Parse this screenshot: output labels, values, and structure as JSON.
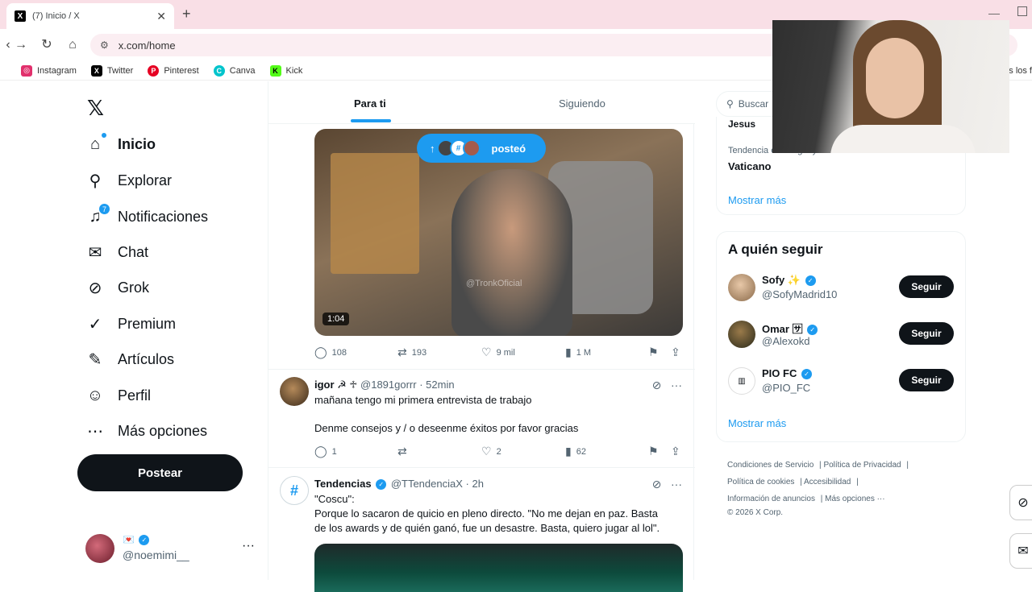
{
  "browser": {
    "tab_title": "(7) Inicio / X",
    "tab_close": "✕",
    "new_tab": "+",
    "url": "x.com/home",
    "bookmarks": [
      {
        "label": "Instagram",
        "color": "#e1306c",
        "glyph": "◎"
      },
      {
        "label": "Twitter",
        "color": "#000000",
        "glyph": "X"
      },
      {
        "label": "Pinterest",
        "color": "#e60023",
        "glyph": "P"
      },
      {
        "label": "Canva",
        "color": "#00c4cc",
        "glyph": "C"
      },
      {
        "label": "Kick",
        "color": "#53fc18",
        "glyph": "K"
      }
    ],
    "bookmarks_more": "as los f"
  },
  "nav": {
    "logo": "𝕏",
    "items": [
      {
        "label": "Inicio",
        "icon": "home-icon",
        "glyph": "⌂"
      },
      {
        "label": "Explorar",
        "icon": "search-icon",
        "glyph": "⚲"
      },
      {
        "label": "Notificaciones",
        "icon": "bell-icon",
        "glyph": "🔔",
        "badge": "7"
      },
      {
        "label": "Chat",
        "icon": "mail-icon",
        "glyph": "✉"
      },
      {
        "label": "Grok",
        "icon": "grok-icon",
        "glyph": "⊘"
      },
      {
        "label": "Premium",
        "icon": "premium-icon",
        "glyph": "✓"
      },
      {
        "label": "Artículos",
        "icon": "articles-icon",
        "glyph": "✎"
      },
      {
        "label": "Perfil",
        "icon": "profile-icon",
        "glyph": "☺"
      },
      {
        "label": "Más opciones",
        "icon": "more-icon",
        "glyph": "⋯"
      }
    ],
    "post_button": "Postear",
    "account": {
      "name": "💌",
      "handle": "@noemimi__",
      "menu": "···"
    }
  },
  "feed": {
    "tabs": [
      "Para ti",
      "Siguiendo"
    ],
    "posted_pill": {
      "arrow": "↑",
      "label": "posteó",
      "avatar_glyph": "#"
    },
    "video": {
      "duration": "1:04",
      "watermark": "@TronkOficial"
    },
    "actions1": {
      "replies": "108",
      "reposts": "193",
      "likes": "9 mil",
      "views": "1 M"
    },
    "post2": {
      "name": "igor ☭ ♱",
      "handle": "@1891gorrr",
      "time": "52min",
      "line1": "mañana tengo mi primera entrevista de trabajo",
      "line2": "Denme consejos y / o deseenme éxitos por favor gracias",
      "replies": "1",
      "reposts": "",
      "likes": "2",
      "views": "62"
    },
    "post3": {
      "name": "Tendencias",
      "handle": "@TTendenciaX",
      "time": "2h",
      "line1": "\"Coscu\":",
      "line2": "Porque lo sacaron de quicio en pleno directo. \"No me dejan en paz. Basta",
      "line3": "de los awards y de quién ganó, fue un desastre. Basta, quiero jugar al lol\"."
    }
  },
  "right": {
    "search_placeholder": "Buscar",
    "trend_prev": "Jesus",
    "trend_meta": "Tendencia en Uruguay",
    "trend_name": "Vaticano",
    "show_more": "Mostrar más",
    "follow_title": "A quién seguir",
    "follow": [
      {
        "name": "Sofy ✨",
        "handle": "@SofyMadrid10",
        "button": "Seguir"
      },
      {
        "name": "Omar 🈂",
        "handle": "@Alexokd",
        "button": "Seguir"
      },
      {
        "name": "PIO FC",
        "handle": "@PIO_FC",
        "button": "Seguir"
      }
    ],
    "footer": {
      "line1a": "Condiciones de Servicio",
      "line1b": "Política de Privacidad",
      "line2a": "Política de cookies",
      "line2b": "Accesibilidad",
      "line3a": "Información de anuncios",
      "line3b": "Más opciones ···",
      "copyright": "© 2026 X Corp."
    }
  }
}
